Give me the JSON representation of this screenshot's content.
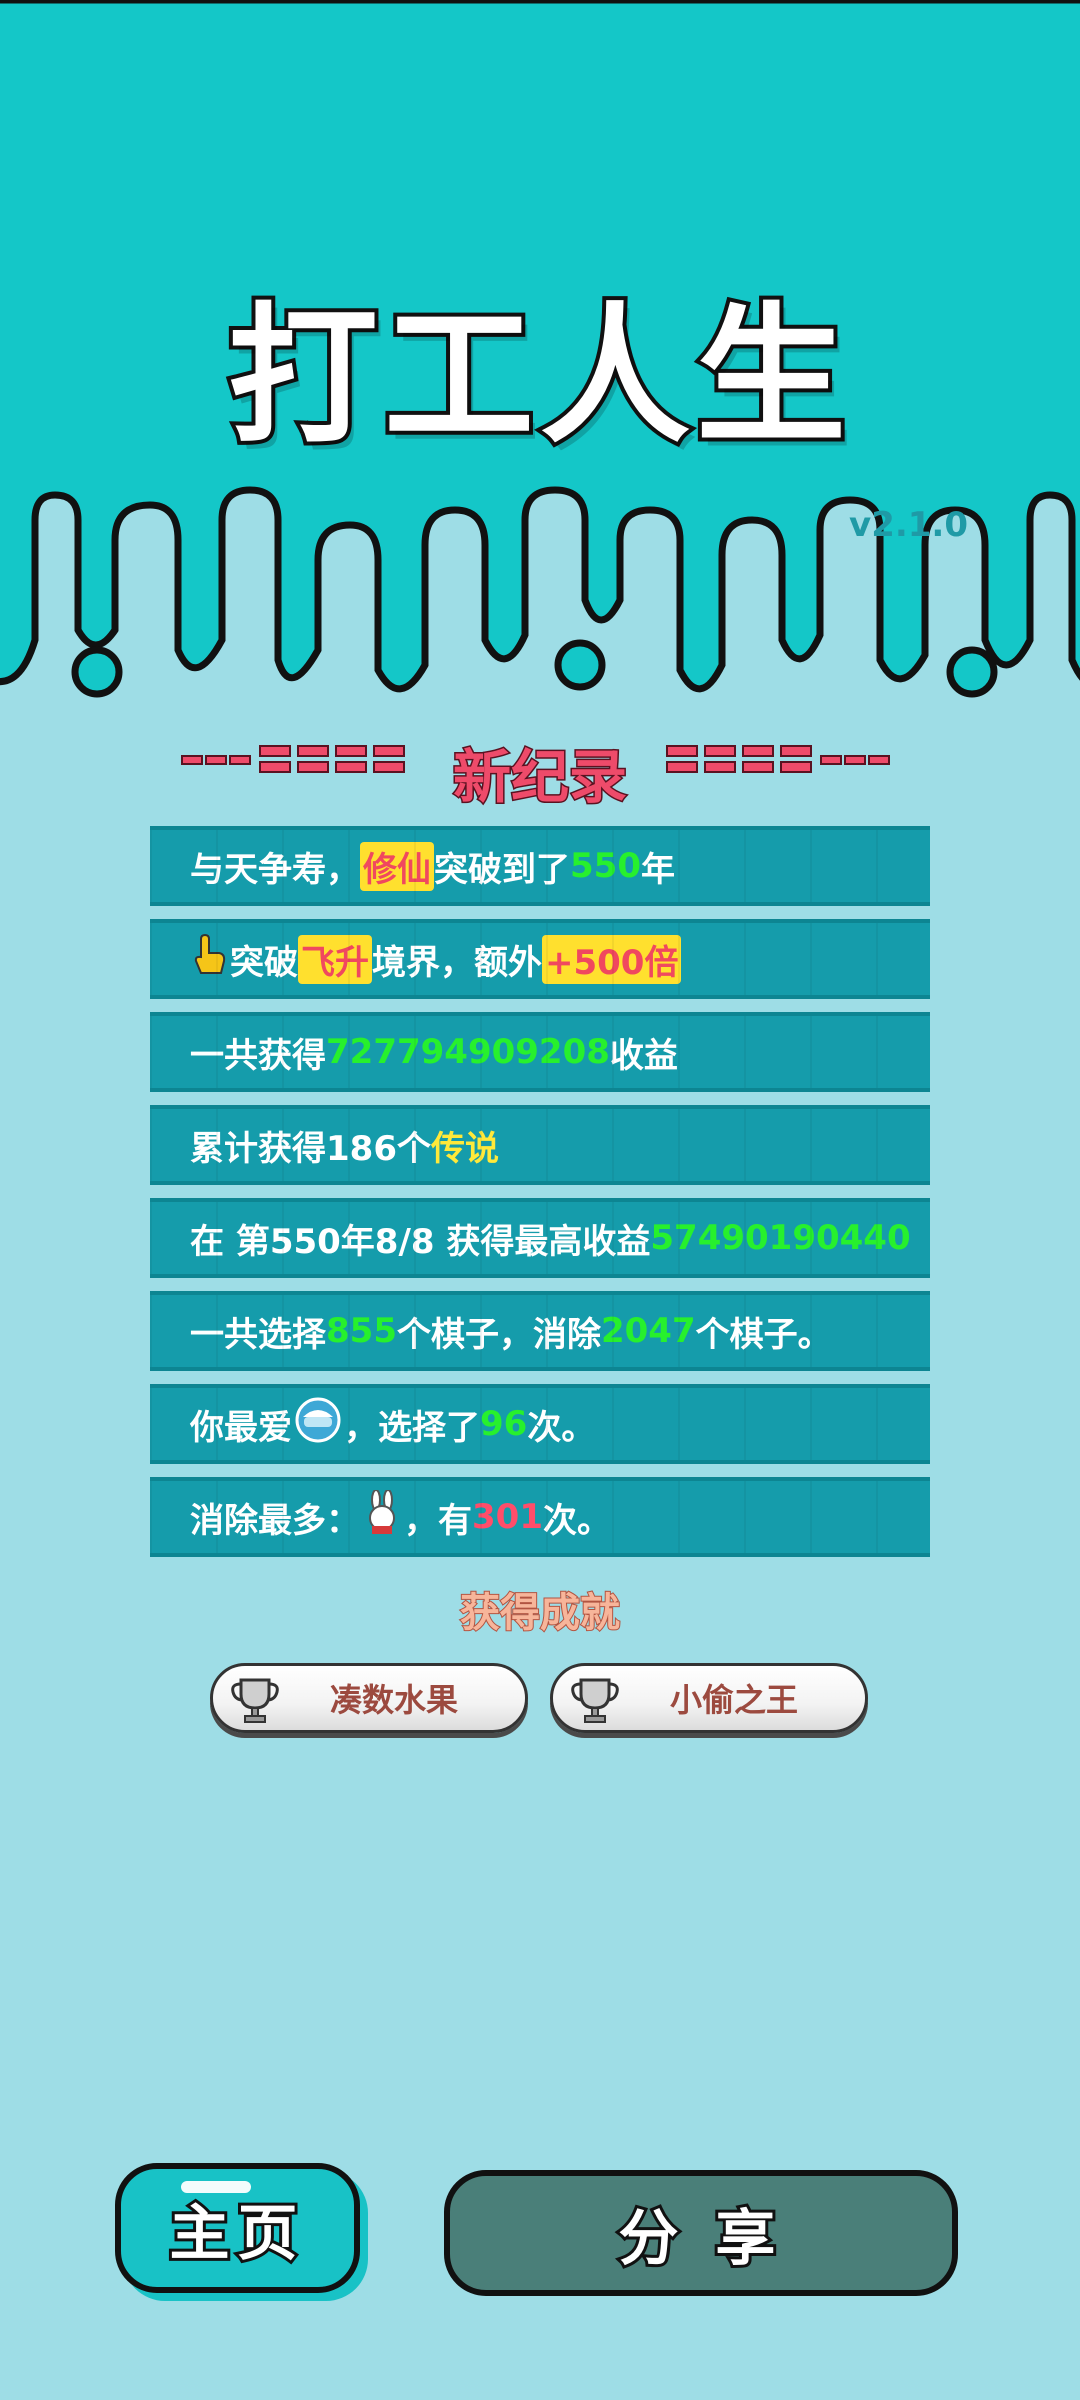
{
  "header": {
    "title": "打工人生",
    "version": "v2.1.0",
    "bg_color": "#14c7c8"
  },
  "record": {
    "title": "新纪录"
  },
  "stats": [
    {
      "parts": [
        {
          "t": "与天争寿，"
        },
        {
          "t": "修仙",
          "s": "hl"
        },
        {
          "t": "突破到了"
        },
        {
          "t": "550",
          "s": "g"
        },
        {
          "t": "年"
        }
      ]
    },
    {
      "icon": "pointing-hand-icon",
      "parts": [
        {
          "t": "突破"
        },
        {
          "t": "飞升",
          "s": "hl"
        },
        {
          "t": "境界，额外"
        },
        {
          "t": "+500倍",
          "s": "hl"
        }
      ]
    },
    {
      "parts": [
        {
          "t": "一共获得"
        },
        {
          "t": "727794909208",
          "s": "g"
        },
        {
          "t": "收益"
        }
      ]
    },
    {
      "parts": [
        {
          "t": "累计获得186个"
        },
        {
          "t": "传说",
          "s": "y"
        }
      ]
    },
    {
      "parts": [
        {
          "t": "在 第550年8/8 获得最高收益"
        },
        {
          "t": "57490190440",
          "s": "g"
        }
      ]
    },
    {
      "parts": [
        {
          "t": "一共选择"
        },
        {
          "t": "855",
          "s": "g"
        },
        {
          "t": "个棋子，消除"
        },
        {
          "t": "2047",
          "s": "g"
        },
        {
          "t": "个棋子。"
        }
      ]
    },
    {
      "parts": [
        {
          "t": "你最爱"
        },
        {
          "icon": "rice-bowl-icon"
        },
        {
          "t": "，选择了"
        },
        {
          "t": "96",
          "s": "g"
        },
        {
          "t": "次。"
        }
      ]
    },
    {
      "parts": [
        {
          "t": "消除最多："
        },
        {
          "icon": "rabbit-icon"
        },
        {
          "t": "，有"
        },
        {
          "t": "301",
          "s": "r"
        },
        {
          "t": "次。"
        }
      ]
    }
  ],
  "achievements": {
    "title": "获得成就",
    "items": [
      {
        "label": "凑数水果",
        "icon": "trophy-icon"
      },
      {
        "label": "小偷之王",
        "icon": "trophy-icon"
      }
    ]
  },
  "buttons": {
    "home": "主页",
    "share": "分 享"
  },
  "colors": {
    "page_bg": "#9edde6",
    "stat_bg": "#159cab",
    "number_green": "#27f02d",
    "legend_yellow": "#ffe93a",
    "record_red": "#ee4b6a"
  }
}
